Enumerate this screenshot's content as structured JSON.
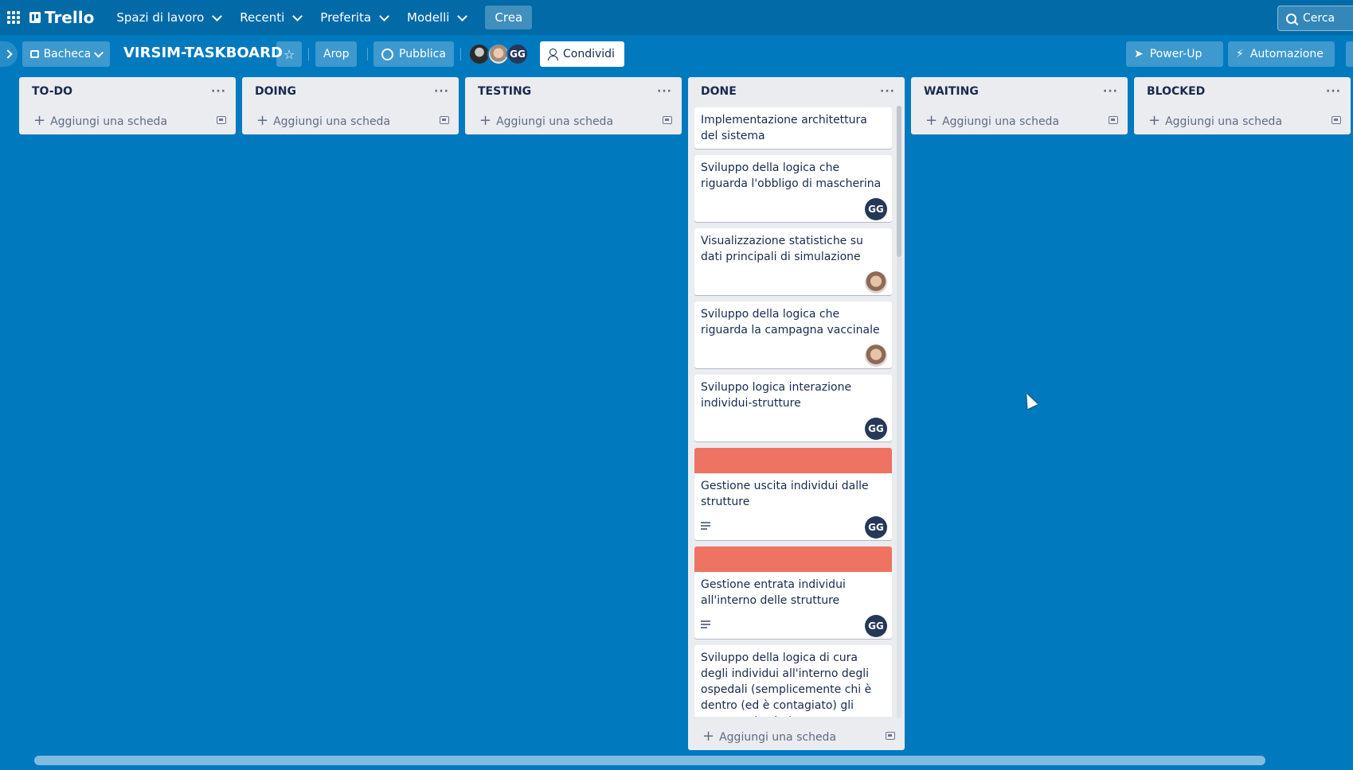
{
  "topnav": {
    "logo": "Trello",
    "items": [
      "Spazi di lavoro",
      "Recenti",
      "Preferita",
      "Modelli"
    ],
    "create": "Crea",
    "search_placeholder": "Cerca"
  },
  "board": {
    "view": "Bacheca",
    "title": "VIRSIM-TASKBOARD",
    "workspace": "Arop",
    "visibility": "Pubblica",
    "members_initials": "GG",
    "share": "Condividi",
    "powerups": "Power-Up",
    "automation": "Automazione"
  },
  "add_card": "Aggiungi una scheda",
  "lists": [
    {
      "title": "TO-DO"
    },
    {
      "title": "DOING"
    },
    {
      "title": "TESTING"
    },
    {
      "title": "DONE"
    },
    {
      "title": "WAITING"
    },
    {
      "title": "BLOCKED"
    }
  ],
  "done_cards": [
    {
      "text": "Implementazione architettura del sistema",
      "member": "",
      "label": false,
      "desc": false
    },
    {
      "text": "Sviluppo della logica che riguarda l'obbligo di mascherina",
      "member": "GG",
      "label": false,
      "desc": false
    },
    {
      "text": "Visualizzazione statistiche su dati principali di simulazione",
      "member": "photo",
      "label": false,
      "desc": false
    },
    {
      "text": "Sviluppo della logica che riguarda la campagna vaccinale",
      "member": "photo",
      "label": false,
      "desc": false
    },
    {
      "text": "Sviluppo logica interazione individui-strutture",
      "member": "GG",
      "label": false,
      "desc": false
    },
    {
      "text": "Gestione uscita individui dalle strutture",
      "member": "GG",
      "label": true,
      "desc": true
    },
    {
      "text": "Gestione entrata individui all'interno delle strutture",
      "member": "GG",
      "label": true,
      "desc": true
    },
    {
      "text": "Sviluppo della logica di cura degli individui all'interno degli ospedali (semplicemente chi è dentro (ed è contagiato) gli aumenta la vita)",
      "member": "",
      "label": false,
      "desc": false
    }
  ],
  "colors": {
    "board_bg": "#0079bf",
    "nav_bg": "#026aa7",
    "label_red": "#eb5a46",
    "list_bg": "#ebecf0"
  }
}
